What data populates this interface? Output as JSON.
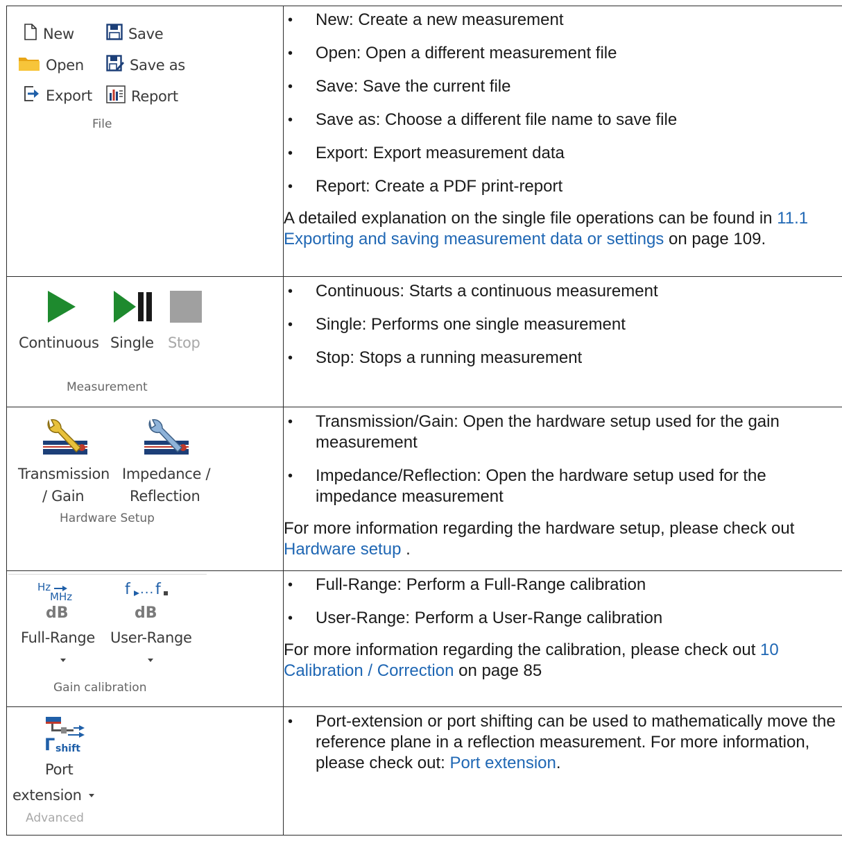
{
  "file": {
    "ribbon": {
      "new": "New",
      "save": "Save",
      "open": "Open",
      "save_as": "Save as",
      "export": "Export",
      "report": "Report",
      "group": "File"
    },
    "bullets": [
      "New: Create a new measurement",
      "Open: Open a different measurement file",
      "Save: Save the current file",
      "Save as: Choose a different file name to save file",
      "Export: Export measurement data",
      "Report: Create a PDF print-report"
    ],
    "note_pre": "A detailed explanation on the single file operations can be found in ",
    "note_link": "11.1 Exporting and saving measurement data or settings",
    "note_post": " on page 109."
  },
  "measurement": {
    "ribbon": {
      "continuous": "Continuous",
      "single": "Single",
      "stop": "Stop",
      "group": "Measurement"
    },
    "bullets": [
      "Continuous: Starts a continuous measurement",
      "Single: Performs one single measurement",
      "Stop: Stops a running measurement"
    ]
  },
  "hardware": {
    "ribbon": {
      "transmission_1": "Transmission",
      "transmission_2": "/ Gain",
      "impedance_1": "Impedance /",
      "impedance_2": "Reflection",
      "group": "Hardware Setup"
    },
    "bullets": [
      "Transmission/Gain: Open the hardware setup used for the gain measurement",
      "Impedance/Reflection: Open the hardware setup used for the impedance measurement"
    ],
    "note_pre": "For more information regarding the hardware setup, please check out ",
    "note_link": "Hardware setup",
    "note_post": " ."
  },
  "calibration": {
    "ribbon": {
      "hz": "Hz",
      "mhz": "MHz",
      "db": "dB",
      "f": "f",
      "full_range": "Full-Range",
      "user_range": "User-Range",
      "group": "Gain calibration"
    },
    "bullets": [
      "Full-Range: Perform a Full-Range calibration",
      "User-Range: Perform a User-Range calibration"
    ],
    "note_pre": "For more information regarding the calibration, please check out ",
    "note_link": "10 Calibration / Correction",
    "note_post": " on page 85"
  },
  "advanced": {
    "ribbon": {
      "shift": "shift",
      "port": "Port",
      "extension": "extension",
      "group": "Advanced"
    },
    "bullet_pre": "Port-extension or port shifting can be used to mathematically move the reference plane in a reflection measurement. For more information, please check out: ",
    "bullet_link": "Port extension",
    "bullet_post": "."
  },
  "colors": {
    "link": "#1f67b4",
    "play_green": "#1e8a2e",
    "stop_gray": "#a0a0a0",
    "folder_yellow": "#f2b51c",
    "icon_blue": "#1f5fa8"
  }
}
